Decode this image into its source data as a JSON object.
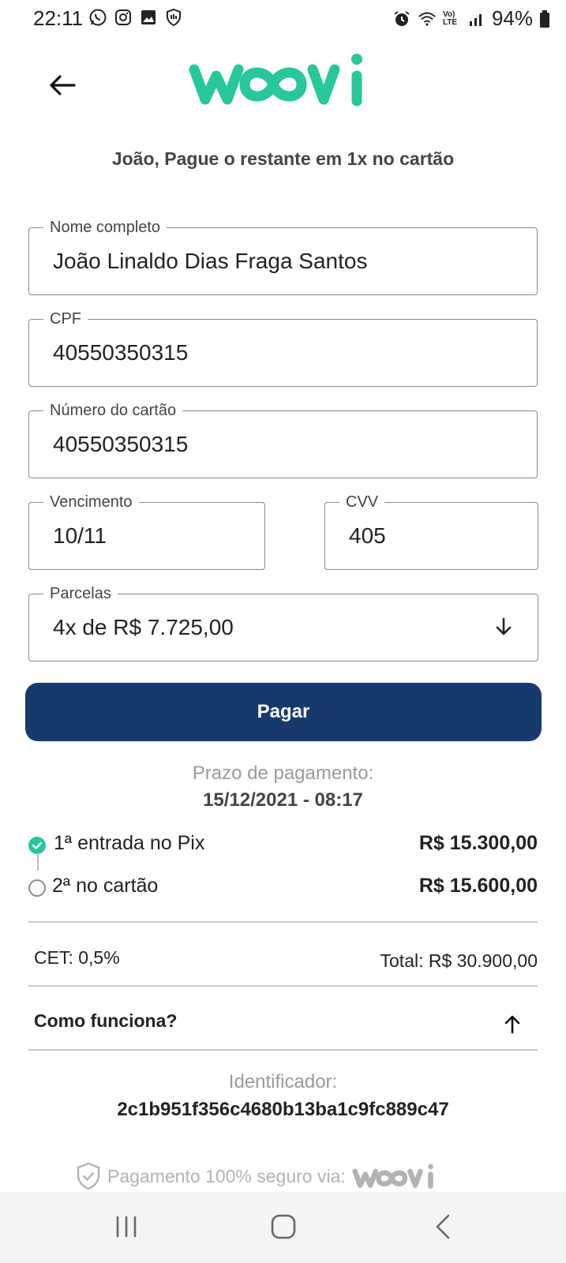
{
  "status": {
    "time": "22:11",
    "battery": "94%",
    "icons_left": [
      "whatsapp-icon",
      "instagram-icon",
      "gallery-icon",
      "shield-hand-icon"
    ],
    "icons_right": [
      "alarm-icon",
      "wifi-icon",
      "volte-icon",
      "signal-icon",
      "battery-icon"
    ],
    "volte_text": "Vo) LTE"
  },
  "header": {
    "logo_text": "woovi",
    "title": "João, Pague o restante em 1x no cartão"
  },
  "form": {
    "name": {
      "label": "Nome completo",
      "value": "João Linaldo Dias Fraga Santos"
    },
    "cpf": {
      "label": "CPF",
      "value": "40550350315"
    },
    "card_number": {
      "label": "Número do cartão",
      "value": "40550350315"
    },
    "expiry": {
      "label": "Vencimento",
      "value": "10/11"
    },
    "cvv": {
      "label": "CVV",
      "value": "405"
    },
    "installments": {
      "label": "Parcelas",
      "value": "4x de R$ 7.725,00"
    }
  },
  "pay_button": "Pagar",
  "deadline": {
    "label": "Prazo de pagamento:",
    "value": "15/12/2021 - 08:17"
  },
  "steps": [
    {
      "label": "1ª entrada no Pix",
      "amount": "R$ 15.300,00",
      "done": true
    },
    {
      "label": "2ª no cartão",
      "amount": "R$ 15.600,00",
      "done": false
    }
  ],
  "summary": {
    "cet": "CET: 0,5%",
    "total": "Total: R$ 30.900,00"
  },
  "how_it_works": "Como funciona?",
  "identifier": {
    "label": "Identificador:",
    "value": "2c1b951f356c4680b13ba1c9fc889c47"
  },
  "secure": {
    "text": "Pagamento 100% seguro via:",
    "logo_text": "woovi"
  },
  "colors": {
    "brand_green": "#27c79a",
    "primary_button": "#163a6b"
  }
}
